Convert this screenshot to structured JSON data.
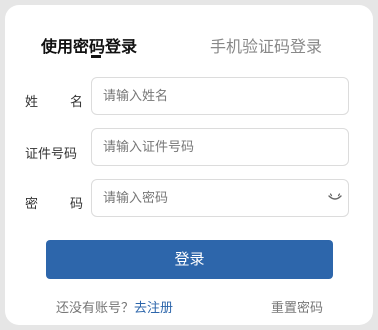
{
  "tabs": {
    "password_login": "使用密码登录",
    "sms_login": "手机验证码登录"
  },
  "form": {
    "name": {
      "label": "姓　名",
      "placeholder": "请输入姓名"
    },
    "id_number": {
      "label": "证件号码",
      "placeholder": "请输入证件号码"
    },
    "password": {
      "label": "密　码",
      "placeholder": "请输入密码",
      "toggle_icon": "eye-closed-icon"
    }
  },
  "login_button": "登录",
  "footer": {
    "no_account": "还没有账号？",
    "register_link": "去注册",
    "reset_password": "重置密码"
  },
  "colors": {
    "accent": "#2d66ab",
    "background": "#e6e6e6",
    "card": "#ffffff"
  }
}
